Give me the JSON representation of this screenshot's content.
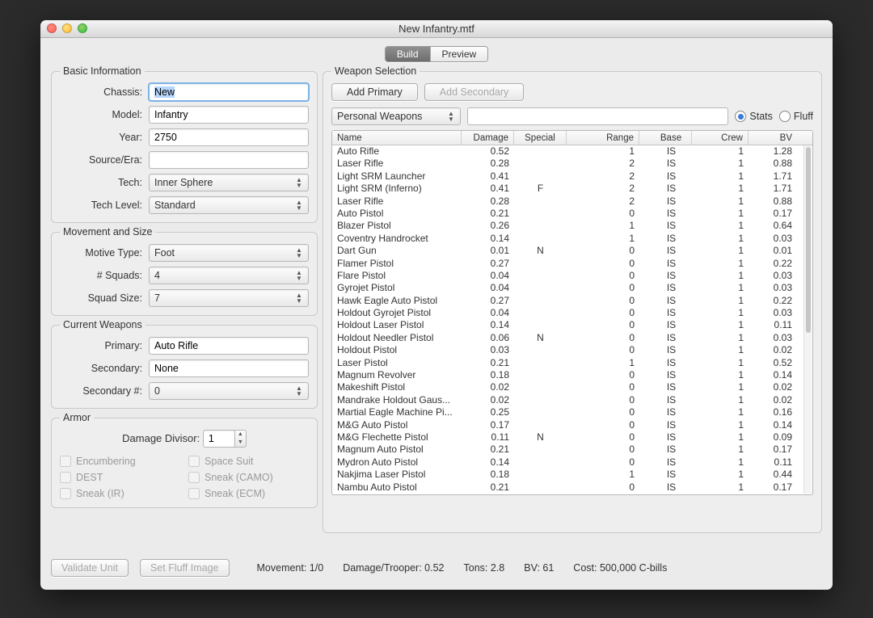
{
  "window": {
    "title": "New Infantry.mtf"
  },
  "tabs": {
    "build": "Build",
    "preview": "Preview"
  },
  "basic": {
    "legend": "Basic Information",
    "chassis_lbl": "Chassis:",
    "chassis_val": "New",
    "model_lbl": "Model:",
    "model_val": "Infantry",
    "year_lbl": "Year:",
    "year_val": "2750",
    "source_lbl": "Source/Era:",
    "source_val": "",
    "tech_lbl": "Tech:",
    "tech_val": "Inner Sphere",
    "techlevel_lbl": "Tech Level:",
    "techlevel_val": "Standard"
  },
  "movement": {
    "legend": "Movement and Size",
    "motive_lbl": "Motive Type:",
    "motive_val": "Foot",
    "squads_lbl": "# Squads:",
    "squads_val": "4",
    "squadsize_lbl": "Squad Size:",
    "squadsize_val": "7"
  },
  "current": {
    "legend": "Current Weapons",
    "primary_lbl": "Primary:",
    "primary_val": "Auto Rifle",
    "secondary_lbl": "Secondary:",
    "secondary_val": "None",
    "secnum_lbl": "Secondary #:",
    "secnum_val": "0"
  },
  "armor": {
    "legend": "Armor",
    "divisor_lbl": "Damage Divisor:",
    "divisor_val": "1",
    "cb": [
      "Encumbering",
      "Space Suit",
      "DEST",
      "Sneak (CAMO)",
      "Sneak (IR)",
      "Sneak (ECM)"
    ]
  },
  "weapons": {
    "legend": "Weapon Selection",
    "add_primary": "Add Primary",
    "add_secondary": "Add Secondary",
    "category": "Personal Weapons",
    "search": "",
    "radio_stats": "Stats",
    "radio_fluff": "Fluff",
    "columns": [
      "Name",
      "Damage",
      "Special",
      "Range",
      "Base",
      "Crew",
      "BV"
    ],
    "rows": [
      {
        "name": "Auto Rifle",
        "dmg": "0.52",
        "spc": "",
        "rng": "1",
        "base": "IS",
        "crew": "1",
        "bv": "1.28"
      },
      {
        "name": "Laser Rifle",
        "dmg": "0.28",
        "spc": "",
        "rng": "2",
        "base": "IS",
        "crew": "1",
        "bv": "0.88"
      },
      {
        "name": "Light SRM Launcher",
        "dmg": "0.41",
        "spc": "",
        "rng": "2",
        "base": "IS",
        "crew": "1",
        "bv": "1.71"
      },
      {
        "name": "Light SRM (Inferno)",
        "dmg": "0.41",
        "spc": "F",
        "rng": "2",
        "base": "IS",
        "crew": "1",
        "bv": "1.71"
      },
      {
        "name": "Laser Rifle",
        "dmg": "0.28",
        "spc": "",
        "rng": "2",
        "base": "IS",
        "crew": "1",
        "bv": "0.88"
      },
      {
        "name": "Auto Pistol",
        "dmg": "0.21",
        "spc": "",
        "rng": "0",
        "base": "IS",
        "crew": "1",
        "bv": "0.17"
      },
      {
        "name": "Blazer Pistol",
        "dmg": "0.26",
        "spc": "",
        "rng": "1",
        "base": "IS",
        "crew": "1",
        "bv": "0.64"
      },
      {
        "name": "Coventry Handrocket",
        "dmg": "0.14",
        "spc": "",
        "rng": "1",
        "base": "IS",
        "crew": "1",
        "bv": "0.03"
      },
      {
        "name": "Dart Gun",
        "dmg": "0.01",
        "spc": "N",
        "rng": "0",
        "base": "IS",
        "crew": "1",
        "bv": "0.01"
      },
      {
        "name": "Flamer Pistol",
        "dmg": "0.27",
        "spc": "",
        "rng": "0",
        "base": "IS",
        "crew": "1",
        "bv": "0.22"
      },
      {
        "name": "Flare Pistol",
        "dmg": "0.04",
        "spc": "",
        "rng": "0",
        "base": "IS",
        "crew": "1",
        "bv": "0.03"
      },
      {
        "name": "Gyrojet Pistol",
        "dmg": "0.04",
        "spc": "",
        "rng": "0",
        "base": "IS",
        "crew": "1",
        "bv": "0.03"
      },
      {
        "name": "Hawk Eagle Auto Pistol",
        "dmg": "0.27",
        "spc": "",
        "rng": "0",
        "base": "IS",
        "crew": "1",
        "bv": "0.22"
      },
      {
        "name": "Holdout Gyrojet Pistol",
        "dmg": "0.04",
        "spc": "",
        "rng": "0",
        "base": "IS",
        "crew": "1",
        "bv": "0.03"
      },
      {
        "name": "Holdout Laser Pistol",
        "dmg": "0.14",
        "spc": "",
        "rng": "0",
        "base": "IS",
        "crew": "1",
        "bv": "0.11"
      },
      {
        "name": "Holdout Needler Pistol",
        "dmg": "0.06",
        "spc": "N",
        "rng": "0",
        "base": "IS",
        "crew": "1",
        "bv": "0.03"
      },
      {
        "name": "Holdout Pistol",
        "dmg": "0.03",
        "spc": "",
        "rng": "0",
        "base": "IS",
        "crew": "1",
        "bv": "0.02"
      },
      {
        "name": "Laser Pistol",
        "dmg": "0.21",
        "spc": "",
        "rng": "1",
        "base": "IS",
        "crew": "1",
        "bv": "0.52"
      },
      {
        "name": "Magnum Revolver",
        "dmg": "0.18",
        "spc": "",
        "rng": "0",
        "base": "IS",
        "crew": "1",
        "bv": "0.14"
      },
      {
        "name": "Makeshift Pistol",
        "dmg": "0.02",
        "spc": "",
        "rng": "0",
        "base": "IS",
        "crew": "1",
        "bv": "0.02"
      },
      {
        "name": "Mandrake Holdout Gaus...",
        "dmg": "0.02",
        "spc": "",
        "rng": "0",
        "base": "IS",
        "crew": "1",
        "bv": "0.02"
      },
      {
        "name": "Martial Eagle Machine Pi...",
        "dmg": "0.25",
        "spc": "",
        "rng": "0",
        "base": "IS",
        "crew": "1",
        "bv": "0.16"
      },
      {
        "name": "M&G Auto Pistol",
        "dmg": "0.17",
        "spc": "",
        "rng": "0",
        "base": "IS",
        "crew": "1",
        "bv": "0.14"
      },
      {
        "name": "M&G Flechette Pistol",
        "dmg": "0.11",
        "spc": "N",
        "rng": "0",
        "base": "IS",
        "crew": "1",
        "bv": "0.09"
      },
      {
        "name": "Magnum Auto Pistol",
        "dmg": "0.21",
        "spc": "",
        "rng": "0",
        "base": "IS",
        "crew": "1",
        "bv": "0.17"
      },
      {
        "name": "Mydron Auto Pistol",
        "dmg": "0.14",
        "spc": "",
        "rng": "0",
        "base": "IS",
        "crew": "1",
        "bv": "0.11"
      },
      {
        "name": "Nakjima Laser Pistol",
        "dmg": "0.18",
        "spc": "",
        "rng": "1",
        "base": "IS",
        "crew": "1",
        "bv": "0.44"
      },
      {
        "name": "Nambu Auto Pistol",
        "dmg": "0.21",
        "spc": "",
        "rng": "0",
        "base": "IS",
        "crew": "1",
        "bv": "0.17"
      }
    ]
  },
  "footer": {
    "validate": "Validate Unit",
    "fluff": "Set Fluff Image",
    "movement": "Movement: 1/0",
    "dpt": "Damage/Trooper: 0.52",
    "tons": "Tons: 2.8",
    "bv": "BV: 61",
    "cost": "Cost: 500,000 C-bills"
  }
}
